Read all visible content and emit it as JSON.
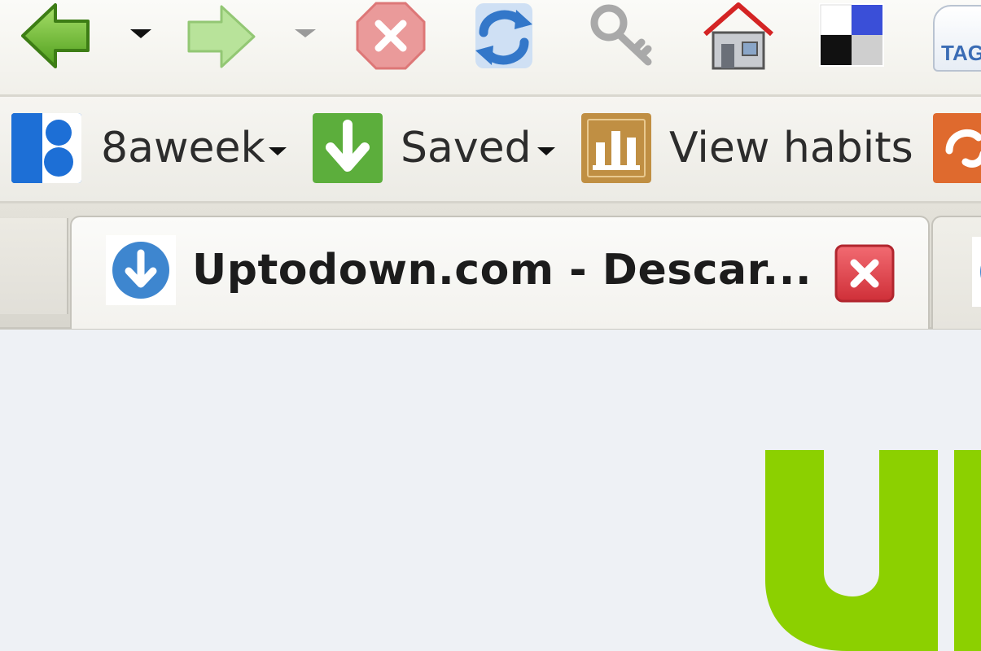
{
  "navigation": {
    "back_icon": "back-arrow-icon",
    "forward_icon": "forward-arrow-icon",
    "stop_icon": "stop-icon",
    "reload_icon": "reload-icon",
    "key_icon": "key-icon",
    "home_icon": "home-icon",
    "delicious_icon": "delicious-icon",
    "tag_label": "TAG"
  },
  "bookmarks": {
    "items": [
      {
        "label": "8aweek",
        "icon": "8aweek-icon",
        "color": "#1d6fd6",
        "has_dropdown": true
      },
      {
        "label": "Saved",
        "icon": "saved-download-icon",
        "color": "#5cae3c",
        "has_dropdown": true
      },
      {
        "label": "View habits",
        "icon": "bar-chart-icon",
        "color": "#c08f43",
        "has_dropdown": false
      }
    ]
  },
  "tabs": [
    {
      "title": "Uptodown.com - Descar...",
      "active": true,
      "favicon": "uptodown-download-icon"
    }
  ],
  "colors": {
    "accent_green": "#8cd000",
    "close_red": "#e0414a",
    "link_blue": "#3e86cf"
  }
}
